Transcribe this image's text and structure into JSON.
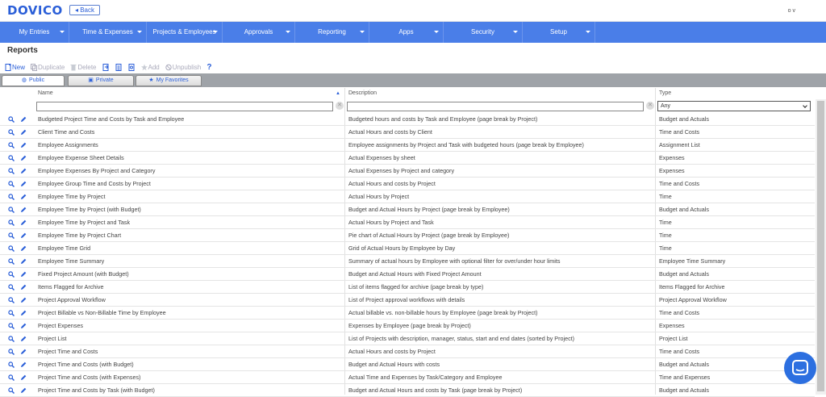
{
  "app": {
    "logo": "DOVICO",
    "back_label": "◂ Back",
    "user": "o v"
  },
  "nav": [
    {
      "label": "My Entries"
    },
    {
      "label": "Time & Expenses"
    },
    {
      "label": "Projects & Employees"
    },
    {
      "label": "Approvals"
    },
    {
      "label": "Reporting"
    },
    {
      "label": "Apps"
    },
    {
      "label": "Security"
    },
    {
      "label": "Setup"
    }
  ],
  "page_title": "Reports",
  "toolbar": {
    "new": "New",
    "duplicate": "Duplicate",
    "delete": "Delete",
    "add": "Add",
    "unpublish": "Unpublish",
    "help": "?"
  },
  "tabs": {
    "public": "Public",
    "private": "Private",
    "favorites": "My Favorites"
  },
  "columns": {
    "name": "Name",
    "description": "Description",
    "type": "Type"
  },
  "type_filter": "Any",
  "rows": [
    {
      "name": "Budgeted Project Time and Costs by Task and Employee",
      "description": "Budgeted hours and costs by Task and Employee (page break by Project)",
      "type": "Budget and Actuals"
    },
    {
      "name": "Client Time and Costs",
      "description": "Actual Hours and costs by Client",
      "type": "Time and Costs"
    },
    {
      "name": "Employee Assignments",
      "description": "Employee assignments by Project and Task with budgeted hours (page break by Employee)",
      "type": "Assignment List"
    },
    {
      "name": "Employee Expense Sheet Details",
      "description": "Actual Expenses by sheet",
      "type": "Expenses"
    },
    {
      "name": "Employee Expenses By Project and Category",
      "description": "Actual Expenses by Project and category",
      "type": "Expenses"
    },
    {
      "name": "Employee Group Time and Costs by Project",
      "description": "Actual Hours and costs by Project",
      "type": "Time and Costs"
    },
    {
      "name": "Employee Time by Project",
      "description": "Actual Hours by Project",
      "type": "Time"
    },
    {
      "name": "Employee Time by Project (with Budget)",
      "description": "Budget and Actual Hours by Project (page break by Employee)",
      "type": "Budget and Actuals"
    },
    {
      "name": "Employee Time by Project and Task",
      "description": "Actual Hours by Project and Task",
      "type": "Time"
    },
    {
      "name": "Employee Time by Project Chart",
      "description": "Pie chart of Actual Hours by Project (page break by Employee)",
      "type": "Time"
    },
    {
      "name": "Employee Time Grid",
      "description": "Grid of Actual Hours by Employee by Day",
      "type": "Time"
    },
    {
      "name": "Employee Time Summary",
      "description": "Summary of actual hours by Employee with optional filter for over/under hour limits",
      "type": "Employee Time Summary"
    },
    {
      "name": "Fixed Project Amount (with Budget)",
      "description": "Budget and Actual Hours with Fixed Project Amount",
      "type": "Budget and Actuals"
    },
    {
      "name": "Items Flagged for Archive",
      "description": "List of items flagged for archive (page break by type)",
      "type": "Items Flagged for Archive"
    },
    {
      "name": "Project Approval Workflow",
      "description": "List of Project approval workflows with details",
      "type": "Project Approval Workflow"
    },
    {
      "name": "Project Billable vs Non-Billable Time by Employee",
      "description": "Actual billable vs. non-billable hours by Employee (page break by Project)",
      "type": "Time and Costs"
    },
    {
      "name": "Project Expenses",
      "description": "Expenses by Employee (page break by Project)",
      "type": "Expenses"
    },
    {
      "name": "Project List",
      "description": "List of Projects with description, manager, status, start and end dates (sorted by Project)",
      "type": "Project List"
    },
    {
      "name": "Project Time and Costs",
      "description": "Actual Hours and costs by Project",
      "type": "Time and Costs"
    },
    {
      "name": "Project Time and Costs (with Budget)",
      "description": "Budget and Actual Hours with costs",
      "type": "Budget and Actuals"
    },
    {
      "name": "Project Time and Costs (with Expenses)",
      "description": "Actual Time and Expenses by Task/Category and Employee",
      "type": "Time and Expenses"
    },
    {
      "name": "Project Time and Costs by Task (with Budget)",
      "description": "Budget and Actual Hours and costs by Task (page break by Project)",
      "type": "Budget and Actuals"
    }
  ]
}
